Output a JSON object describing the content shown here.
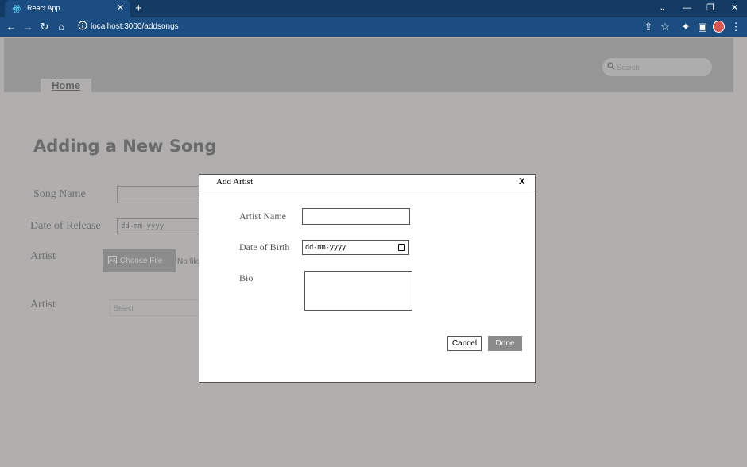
{
  "browser": {
    "tab_title": "React App",
    "tab_close": "✕",
    "new_tab": "+",
    "url": "localhost:3000/addsongs",
    "window_controls": {
      "dropdown": "⌄",
      "minimize": "—",
      "restore": "❐",
      "close": "✕"
    }
  },
  "header": {
    "nav_home": "Home",
    "search_placeholder": "Search"
  },
  "form": {
    "title": "Adding a New Song",
    "song_name_label": "Song Name",
    "release_label": "Date of Release",
    "release_placeholder": "dd-mm-yyyy",
    "artist_file_label": "Artist",
    "choose_file": "Choose File",
    "no_file": "No file",
    "artist_select_label": "Artist",
    "artist_select_value": "Select"
  },
  "modal": {
    "title": "Add Artist",
    "close": "X",
    "artist_name_label": "Artist Name",
    "artist_name_value": "",
    "dob_label": "Date of Birth",
    "dob_placeholder": "dd-mm-yyyy",
    "bio_label": "Bio",
    "bio_value": "",
    "cancel": "Cancel",
    "done": "Done"
  },
  "colors": {
    "tabstrip": "#123a63",
    "toolbar": "#1b4d80",
    "page_bg": "#b0afae",
    "header_band": "#979696",
    "done_button": "#8b8b8b"
  }
}
